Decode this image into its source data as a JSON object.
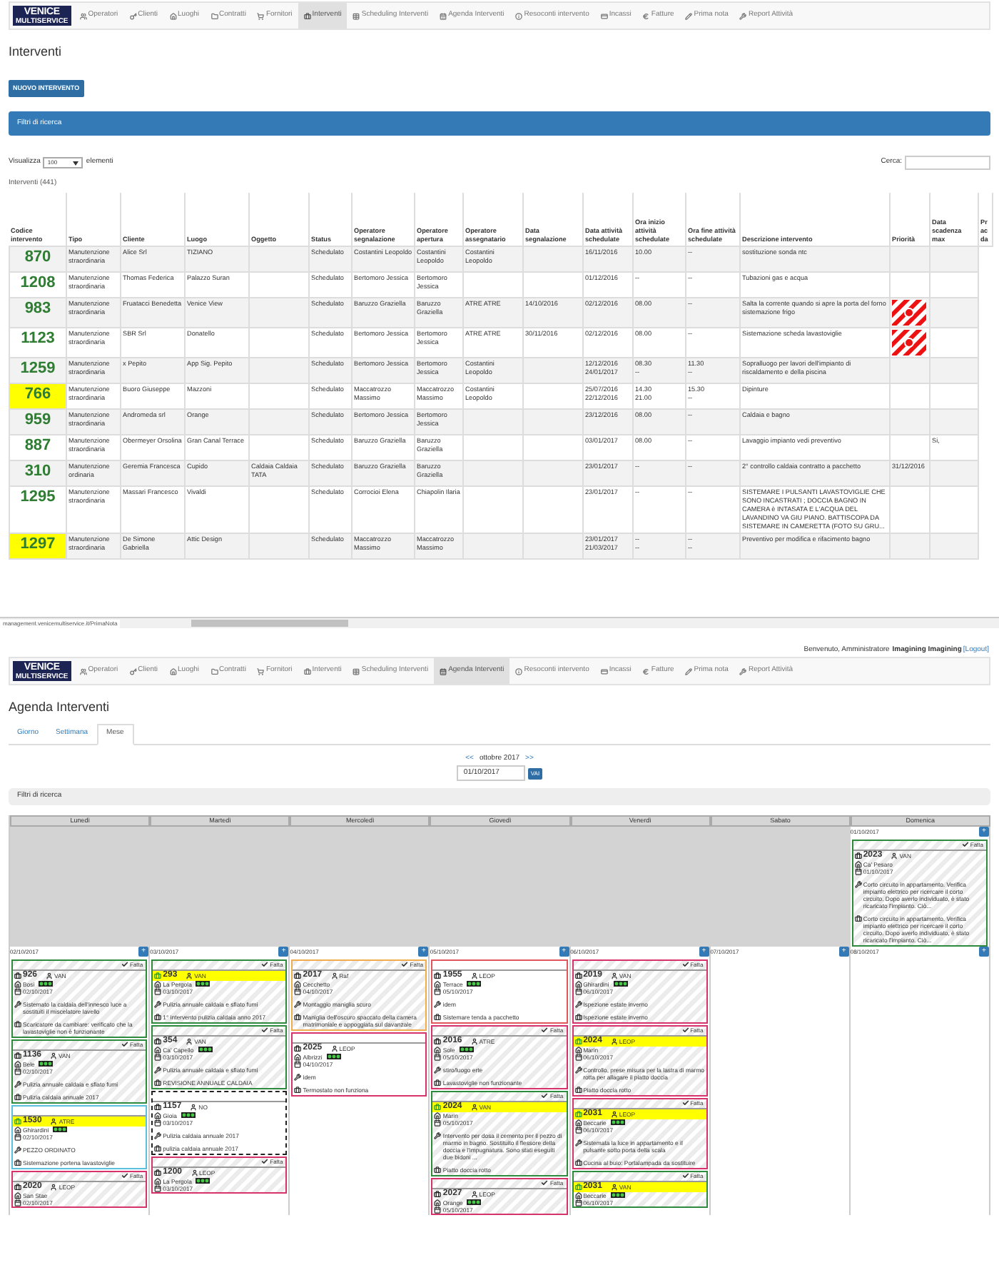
{
  "top": {
    "nav": {
      "logo": [
        "VENICE",
        "MULTISERVICE"
      ],
      "items": [
        {
          "label": "Operatori",
          "selected": false
        },
        {
          "label": "Clienti",
          "selected": false
        },
        {
          "label": "Luoghi",
          "selected": false
        },
        {
          "label": "Contratti",
          "selected": false
        },
        {
          "label": "Fornitori",
          "selected": false
        },
        {
          "label": "Interventi",
          "selected": true
        },
        {
          "label": "Scheduling Interventi",
          "selected": false
        },
        {
          "label": "Agenda Interventi",
          "selected": false
        },
        {
          "label": "Resoconti intervento",
          "selected": false
        },
        {
          "label": "Incassi",
          "selected": false
        },
        {
          "label": "Fatture",
          "selected": false
        },
        {
          "label": "Prima nota",
          "selected": false
        },
        {
          "label": "Report Attività",
          "selected": false
        }
      ]
    },
    "title": "Interventi",
    "new_button": "NUOVO INTERVENTO",
    "filter_bar": "Filtri di ricerca",
    "length": {
      "before": "Visualizza",
      "value": "100",
      "after": "elementi"
    },
    "search_label": "Cerca:",
    "table_caption": "Interventi (441)",
    "table": {
      "columns": [
        "Codice intervento",
        "Tipo",
        "Cliente",
        "Luogo",
        "Oggetto",
        "Status",
        "Operatore segnalazione",
        "Operatore apertura",
        "Operatore assegnatario",
        "Data segnalazione",
        "Data attività schedulate",
        "Ora inizio attività schedulate",
        "Ora fine attività schedulate",
        "Descrizione intervento",
        "Priorità",
        "Data scadenza max",
        "Pr ac da"
      ],
      "rows": [
        {
          "highlighted": false,
          "urgent": false,
          "cells": [
            "870",
            "Manutenzione straordinaria",
            "Alice Srl",
            "TIZIANO",
            "",
            "Schedulato",
            "Costantini Leopoldo",
            "Costantini Leopoldo",
            "Costantini Leopoldo",
            "",
            "16/11/2016",
            "10.00",
            "--",
            "sostituzione sonda ntc",
            "",
            ""
          ]
        },
        {
          "highlighted": false,
          "urgent": false,
          "cells": [
            "1208",
            "Manutenzione straordinaria",
            "Thomas Federica",
            "Palazzo Suran",
            "",
            "Schedulato",
            "Bertomoro Jessica",
            "Bertomoro Jessica",
            "",
            "",
            "01/12/2016",
            "--",
            "--",
            "Tubazioni gas e acqua",
            "",
            ""
          ]
        },
        {
          "highlighted": false,
          "urgent": true,
          "cells": [
            "983",
            "Manutenzione straordinaria",
            "Fruatacci Benedetta",
            "Venice View",
            "",
            "Schedulato",
            "Baruzzo Graziella",
            "Baruzzo Graziella",
            "ATRE ATRE",
            "14/10/2016",
            "02/12/2016",
            "08.00",
            "--",
            "Salta la corrente quando si apre la porta del forno sistemazione frigo",
            "",
            ""
          ]
        },
        {
          "highlighted": false,
          "urgent": true,
          "cells": [
            "1123",
            "Manutenzione straordinaria",
            "SBR Srl",
            "Donatello",
            "",
            "Schedulato",
            "Bertomoro Jessica",
            "Bertomoro Jessica",
            "ATRE ATRE",
            "30/11/2016",
            "02/12/2016",
            "08.00",
            "--",
            "Sistemazione scheda lavastoviglie",
            "",
            ""
          ]
        },
        {
          "highlighted": false,
          "urgent": false,
          "cells": [
            "1259",
            "Manutenzione straordinaria",
            "x Pepito",
            "App Sig. Pepito",
            "",
            "Schedulato",
            "Bertomoro Jessica",
            "Bertomoro Jessica",
            "Costantini Leopoldo",
            "",
            "12/12/2016\n24/01/2017",
            "08.30\n--",
            "11.30\n--",
            "Sopralluogo per lavori dell'impianto di riscaldamento e della piscina",
            "",
            ""
          ]
        },
        {
          "highlighted": true,
          "urgent": false,
          "cells": [
            "766",
            "Manutenzione straordinaria",
            "Buoro Giuseppe",
            "Mazzoni",
            "",
            "Schedulato",
            "Maccatrozzo Massimo",
            "Maccatrozzo Massimo",
            "Costantini Leopoldo",
            "",
            "25/07/2016\n22/12/2016",
            "14.30\n21.00",
            "15.30\n--",
            "Dipinture",
            "",
            ""
          ]
        },
        {
          "highlighted": false,
          "urgent": false,
          "cells": [
            "959",
            "Manutenzione straordinaria",
            "Andromeda srl",
            "Orange",
            "",
            "Schedulato",
            "Bertomoro Jessica",
            "Bertomoro Jessica",
            "",
            "",
            "23/12/2016",
            "08.00",
            "--",
            "Caldaia e bagno",
            "",
            ""
          ]
        },
        {
          "highlighted": false,
          "urgent": false,
          "cells": [
            "887",
            "Manutenzione straordinaria",
            "Obermeyer Orsolina",
            "Gran Canal Terrace",
            "",
            "Schedulato",
            "Baruzzo Graziella",
            "Baruzzo Graziella",
            "",
            "",
            "03/01/2017",
            "08.00",
            "--",
            "Lavaggio impianto vedi preventivo",
            "",
            "Si,"
          ]
        },
        {
          "highlighted": false,
          "urgent": false,
          "cells": [
            "310",
            "Manutenzione ordinaria",
            "Geremia Francesca",
            "Cupido",
            "Caldaia Caldaia TATA",
            "Schedulato",
            "Baruzzo Graziella",
            "Baruzzo Graziella",
            "",
            "",
            "23/01/2017",
            "--",
            "--",
            "2° controllo caldaia contratto a pacchetto",
            "31/12/2016",
            ""
          ]
        },
        {
          "highlighted": false,
          "urgent": false,
          "cells": [
            "1295",
            "Manutenzione straordinaria",
            "Massari Francesco",
            "Vivaldi",
            "",
            "Schedulato",
            "Corrocioi Elena",
            "Chiapolin Ilaria",
            "",
            "",
            "23/01/2017",
            "--",
            "--",
            "SISTEMARE I PULSANTI LAVASTOVIGLIE CHE SONO INCASTRATI ; DOCCIA BAGNO IN CAMERA è INTASATA E L'ACQUA DEL LAVANDINO VA GIU PIANO. BATTISCOPA DA SISTEMARE IN CAMERETTA (FOTO SU GRU...",
            "",
            ""
          ]
        },
        {
          "highlighted": true,
          "urgent": false,
          "cells": [
            "1297",
            "Manutenzione straordinaria",
            "De Simone Gabriella",
            "Attic Design",
            "",
            "Schedulato",
            "Maccatrozzo Massimo",
            "Maccatrozzo Massimo",
            "",
            "",
            "23/01/2017\n21/03/2017",
            "--\n--",
            "--\n--",
            "Preventivo per modifica e rifacimento bagno",
            "",
            ""
          ]
        }
      ]
    },
    "status_url": "management.venicemultiservice.it/PrimaNota"
  },
  "bottom": {
    "welcome": {
      "text": "Benvenuto, Amministratore",
      "user": "Imagining Imagining",
      "logout": "[Logout]"
    },
    "nav": {
      "logo": [
        "VENICE",
        "MULTISERVICE"
      ],
      "items": [
        {
          "label": "Operatori",
          "selected": false
        },
        {
          "label": "Clienti",
          "selected": false
        },
        {
          "label": "Luoghi",
          "selected": false
        },
        {
          "label": "Contratti",
          "selected": false
        },
        {
          "label": "Fornitori",
          "selected": false
        },
        {
          "label": "Interventi",
          "selected": false
        },
        {
          "label": "Scheduling Interventi",
          "selected": false
        },
        {
          "label": "Agenda Interventi",
          "selected": true
        },
        {
          "label": "Resoconti intervento",
          "selected": false
        },
        {
          "label": "Incassi",
          "selected": false
        },
        {
          "label": "Fatture",
          "selected": false
        },
        {
          "label": "Prima nota",
          "selected": false
        },
        {
          "label": "Report Attività",
          "selected": false
        }
      ]
    },
    "title": "Agenda Interventi",
    "tabs": [
      {
        "label": "Giorno",
        "selected": false
      },
      {
        "label": "Settimana",
        "selected": false
      },
      {
        "label": "Mese",
        "selected": true
      }
    ],
    "month": {
      "prev": "<<",
      "label": "ottobre 2017",
      "next": ">>",
      "date": "01/10/2017",
      "go": "VAI"
    },
    "filter_bar": "Filtri di ricerca",
    "days": [
      "Lunedì",
      "Martedì",
      "Mercoledì",
      "Giovedì",
      "Venerdì",
      "Sabato",
      "Domenica"
    ],
    "weeks": [
      [
        {
          "in_month": false
        },
        {
          "in_month": false
        },
        {
          "in_month": false
        },
        {
          "in_month": false
        },
        {
          "in_month": false
        },
        {
          "in_month": false
        },
        {
          "in_month": true,
          "date": "01/10/2017",
          "add": "+",
          "cards": [
            {
              "code": "2023",
              "operator": "VAN",
              "place": "Ca' Pesaro",
              "date": "01/10/2017",
              "work": "Corto circuito in appartamento. Verifica impianto elettrico per ricercare il corto circuito. Dopo averlo individuato, è stato ricaricato l'impianto. Ciò...",
              "note": "Corto circuito in appartamento. Verifica impianto elettrico per ricercare il corto circuito. Dopo averlo individuato, è stato ricaricato l'impianto. Ciò...",
              "done": true,
              "badge": "Fatta",
              "highlighted": false,
              "lights": false,
              "dashed": false,
              "color": "#2e8b3d"
            }
          ]
        }
      ],
      [
        {
          "in_month": true,
          "date": "02/10/2017",
          "add": "+",
          "cards": [
            {
              "code": "926",
              "operator": "VAN",
              "place": "Bosi",
              "date": "02/10/2017",
              "work": "Sistemato la caldaia dell'innesco luce a sostituiti il miscelatore lavello",
              "note": "Scaricatore da cambiare: verificato che la lavastoviglie non è funzionante",
              "done": true,
              "badge": "Fatta",
              "highlighted": false,
              "lights": true,
              "dashed": false,
              "color": "#2e8b3d"
            },
            {
              "code": "1136",
              "operator": "VAN",
              "place": "Bele",
              "date": "02/10/2017",
              "work": "Pulizia annuale caldaia e sfiato fumi",
              "note": "Pulizia caldaia annuale 2017",
              "done": true,
              "badge": "Fatta",
              "highlighted": false,
              "lights": true,
              "dashed": false,
              "color": "#2e8b3d"
            },
            {
              "code": "1530",
              "operator": "ATRE",
              "place": "Ghirardini",
              "date": "02/10/2017",
              "work": "PEZZO ORDINATO",
              "note": "Sistemazione portena lavastoviglie",
              "done": false,
              "highlighted": true,
              "lights": true,
              "dashed": false,
              "color": "#5bc0de"
            },
            {
              "code": "2020",
              "operator": "LEOP",
              "place": "San Stae",
              "date": "02/10/2017",
              "done": true,
              "badge": "Fatta",
              "highlighted": false,
              "lights": false,
              "dashed": false,
              "color": "#d6336c"
            }
          ]
        },
        {
          "in_month": true,
          "date": "03/10/2017",
          "add": "+",
          "cards": [
            {
              "code": "293",
              "operator": "VAN",
              "place": "La Pergola",
              "date": "03/10/2017",
              "work": "Pulizia annuale caldaia e sfiato fumi",
              "note": "1° intervento pulizia caldaia anno 2017",
              "done": true,
              "badge": "Fatta",
              "highlighted": true,
              "lights": true,
              "dashed": false,
              "color": "#2e8b3d"
            },
            {
              "code": "354",
              "operator": "VAN",
              "place": "Ca' Capello",
              "date": "03/10/2017",
              "work": "Pulizia annuale caldaia e sfiato fumi",
              "note": "REVISIONE ANNUALE CALDAIA",
              "done": true,
              "badge": "Fatta",
              "highlighted": false,
              "lights": true,
              "dashed": false,
              "color": "#2e8b3d"
            },
            {
              "code": "1157",
              "operator": "NO",
              "place": "Gioia",
              "date": "03/10/2017",
              "work": "Pulizia caldaia annuale 2017",
              "note": "pulizia caldaia annuale 2017",
              "done": false,
              "highlighted": false,
              "lights": true,
              "dashed": true,
              "color": "#222222"
            },
            {
              "code": "1200",
              "operator": "LEOP",
              "place": "La Pergola",
              "date": "03/10/2017",
              "done": true,
              "badge": "Fatta",
              "highlighted": false,
              "lights": true,
              "dashed": false,
              "color": "#d6336c"
            }
          ]
        },
        {
          "in_month": true,
          "date": "04/10/2017",
          "add": "+",
          "cards": [
            {
              "code": "2017",
              "operator": "Raf",
              "place": "Cecchetto",
              "date": "04/10/2017",
              "work": "Montaggio maniglia scuro",
              "note": "Maniglia dell'oscuro spaccato della camera matrimoniale e appoggiata sul davanzale",
              "done": true,
              "badge": "Fatta",
              "highlighted": false,
              "lights": false,
              "dashed": false,
              "color": "#f0ad4e"
            },
            {
              "code": "2025",
              "operator": "LEOP",
              "place": "Albrizzi",
              "date": "04/10/2017",
              "work": "idem",
              "note": "Termostato non funziona",
              "done": false,
              "highlighted": false,
              "lights": true,
              "dashed": false,
              "color": "#d6336c"
            }
          ]
        },
        {
          "in_month": true,
          "date": "05/10/2017",
          "add": "+",
          "cards": [
            {
              "code": "1955",
              "operator": "LEOP",
              "place": "Terrace",
              "date": "05/10/2017",
              "work": "idem",
              "note": "Sistemare tenda a pacchetto",
              "done": false,
              "highlighted": false,
              "lights": true,
              "dashed": false,
              "color": "#e0565b"
            },
            {
              "code": "2016",
              "operator": "ATRE",
              "place": "Sole",
              "date": "05/10/2017",
              "work": "stiro/luogo erte",
              "note": "Lavastoviglie non funzionante",
              "done": true,
              "badge": "Fatta",
              "highlighted": false,
              "lights": true,
              "dashed": false,
              "color": "#d6336c"
            },
            {
              "code": "2024",
              "operator": "VAN",
              "place": "Marin",
              "date": "05/10/2017",
              "work": "Intervento per dosa il cemento per il pezzo di marmo in bagno. Sostituito il flessore della doccia e l'impugnatura. Sono stati eseguiti due bidoni ...",
              "note": "Piatto doccia rotto",
              "done": true,
              "badge": "Fatta",
              "highlighted": true,
              "lights": false,
              "dashed": false,
              "color": "#2e8b3d"
            },
            {
              "code": "2027",
              "operator": "LEOP",
              "place": "Orange",
              "date": "05/10/2017",
              "done": true,
              "badge": "Fatta",
              "highlighted": false,
              "lights": true,
              "dashed": false,
              "color": "#d6336c"
            }
          ]
        },
        {
          "in_month": true,
          "date": "06/10/2017",
          "add": "+",
          "cards": [
            {
              "code": "2019",
              "operator": "VAN",
              "place": "Ghirardini",
              "date": "06/10/2017",
              "work": "Ispezione estate inverno",
              "note": "Ispezione estate inverno",
              "done": true,
              "badge": "Fatta",
              "highlighted": false,
              "lights": true,
              "dashed": false,
              "color": "#d6336c"
            },
            {
              "code": "2024",
              "operator": "LEOP",
              "place": "Marin",
              "date": "06/10/2017",
              "work": "Controllo, prese misura per la lastra di marmo rotta per allagare il piatto doccia",
              "note": "Piatto doccia rotto",
              "done": true,
              "badge": "Fatta",
              "highlighted": true,
              "lights": false,
              "dashed": false,
              "color": "#d6336c"
            },
            {
              "code": "2031",
              "operator": "LEOP",
              "place": "Beccarie",
              "date": "06/10/2017",
              "work": "Sistemata la luce in appartamento e il pulsante sotto porta della scala",
              "note": "Cucina al buio: Portalampada da sostituire",
              "done": true,
              "badge": "Fatta",
              "highlighted": true,
              "lights": true,
              "dashed": false,
              "color": "#d6336c"
            },
            {
              "code": "2031",
              "operator": "VAN",
              "place": "Beccarie",
              "date": "06/10/2017",
              "done": true,
              "badge": "Fatta",
              "highlighted": true,
              "lights": true,
              "dashed": false,
              "color": "#2e8b3d"
            }
          ]
        },
        {
          "in_month": true,
          "date": "07/10/2017",
          "add": "+"
        },
        {
          "in_month": true,
          "date": "08/10/2017",
          "add": "+"
        }
      ]
    ]
  }
}
